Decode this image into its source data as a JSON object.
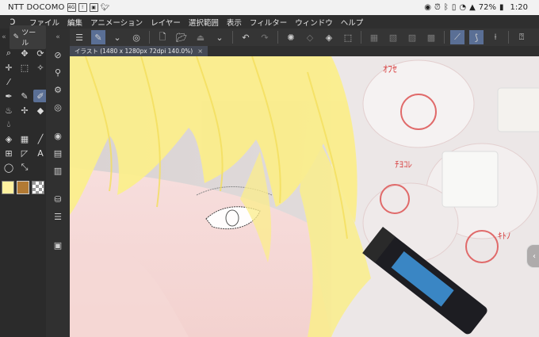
{
  "status_bar": {
    "carrier": "NTT DOCOMO",
    "battery": "72%",
    "time": "1:20",
    "icons": [
      "signal-icon",
      "notification-icon",
      "photo-icon",
      "twitter-icon",
      "eye-icon",
      "alarm-icon",
      "bluetooth-icon",
      "vibrate-icon",
      "wifi-icon",
      "cell-signal-icon",
      "battery-icon"
    ]
  },
  "menu": {
    "items": [
      "ファイル",
      "編集",
      "アニメーション",
      "レイヤー",
      "選択範囲",
      "表示",
      "フィルター",
      "ウィンドウ",
      "ヘルプ"
    ]
  },
  "tool_panel": {
    "tab_label": "ツール",
    "tools": [
      "zoom-icon",
      "hand-icon",
      "rotate-icon",
      "move-icon",
      "marquee-icon",
      "wand-icon",
      "eyedropper-icon",
      "pen-icon",
      "pencil-icon",
      "brush-icon",
      "airbrush-icon",
      "deco-icon",
      "eraser-icon",
      "blend-icon",
      "fill-icon",
      "gradient-icon",
      "figure-icon",
      "frame-icon",
      "ruler-icon",
      "text-icon",
      "balloon-icon",
      "line-correction-icon"
    ],
    "selected_tool": "brush-icon",
    "colors": {
      "main": "#fff2a0",
      "sub": "#b27a34"
    }
  },
  "document_tab": {
    "title": "イラスト (1480 x 1280px 72dpi 140.0%)",
    "close": "×"
  },
  "accent_color": "#5a6f95"
}
